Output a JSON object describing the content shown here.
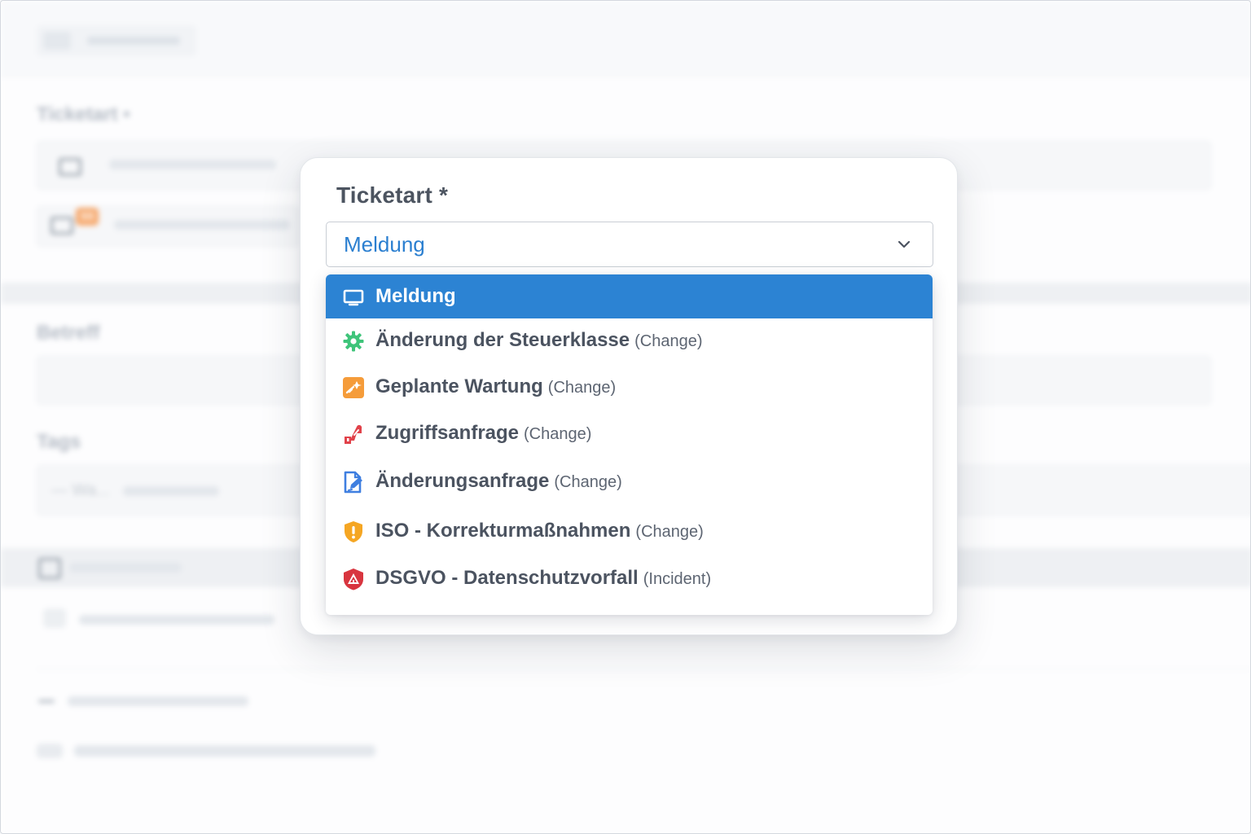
{
  "background": {
    "labels": [
      "Ticketart •",
      "Betreff",
      "Tags"
    ],
    "badge": "55",
    "tags_placeholder": "— Wa..."
  },
  "ticket_type": {
    "label": "Ticketart *",
    "selected_value": "Meldung",
    "options": [
      {
        "label": "Meldung",
        "type": "",
        "icon": "monitor-icon",
        "color": "#ffffff",
        "selected": true
      },
      {
        "label": "Änderung der Steuerklasse",
        "type": "(Change)",
        "icon": "gear-icon",
        "color": "#3fc47a"
      },
      {
        "label": "Geplante Wartung",
        "type": "(Change)",
        "icon": "maintenance-icon",
        "color": "#f59c3a"
      },
      {
        "label": "Zugriffsanfrage",
        "type": "(Change)",
        "icon": "access-request-icon",
        "color": "#e1424a"
      },
      {
        "label": "Änderungsanfrage",
        "type": "(Change)",
        "icon": "edit-document-icon",
        "color": "#3f7fe0"
      },
      {
        "label": "ISO - Korrekturmaßnahmen",
        "type": "(Change)",
        "icon": "shield-warning-icon",
        "color": "#f5a623"
      },
      {
        "label": "DSGVO - Datenschutzvorfall",
        "type": "(Incident)",
        "icon": "shield-alert-icon",
        "color": "#d8353f"
      }
    ]
  }
}
